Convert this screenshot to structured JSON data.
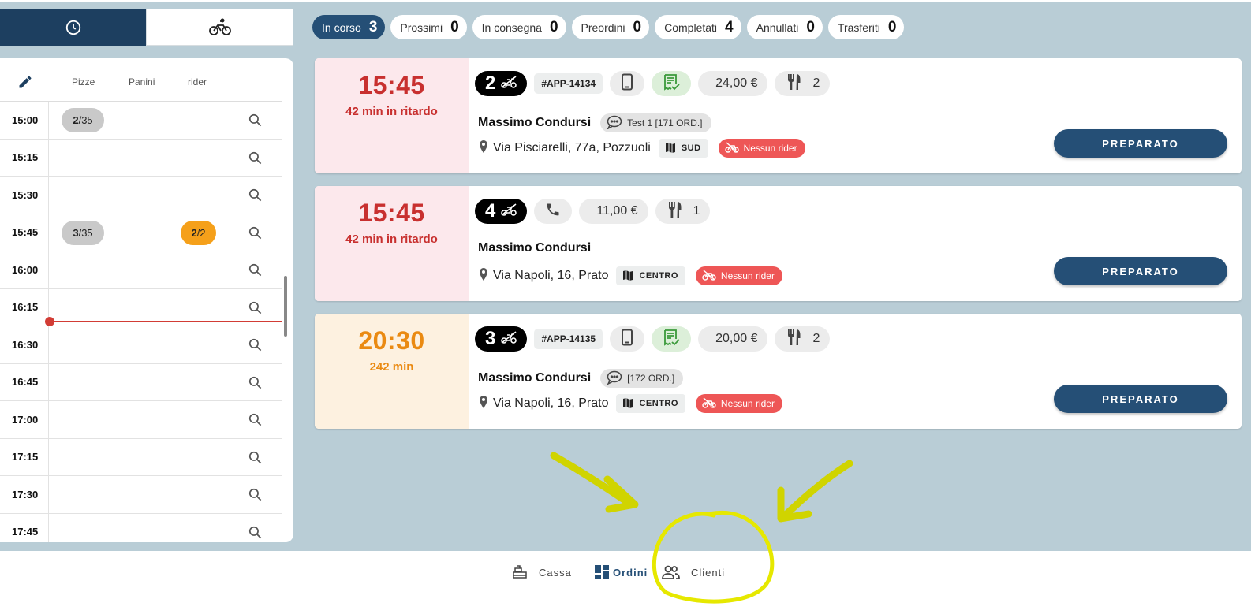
{
  "view_tabs": [
    {
      "icon": "clock-icon",
      "active": true
    },
    {
      "icon": "bicycle-icon",
      "active": false
    }
  ],
  "filters": [
    {
      "label": "In corso",
      "count": "3",
      "active": true
    },
    {
      "label": "Prossimi",
      "count": "0"
    },
    {
      "label": "In consegna",
      "count": "0"
    },
    {
      "label": "Preordini",
      "count": "0"
    },
    {
      "label": "Completati",
      "count": "4"
    },
    {
      "label": "Annullati",
      "count": "0"
    },
    {
      "label": "Trasferiti",
      "count": "0"
    }
  ],
  "schedule": {
    "columns": [
      "Pizze",
      "Panini",
      "rider"
    ],
    "rows": [
      {
        "time": "15:00",
        "pizze_num": "2",
        "pizze_den": "/35",
        "rider_num": null,
        "rider_den": null
      },
      {
        "time": "15:15"
      },
      {
        "time": "15:30"
      },
      {
        "time": "15:45",
        "pizze_num": "3",
        "pizze_den": "/35",
        "rider_num": "2",
        "rider_den": "/2"
      },
      {
        "time": "16:00"
      },
      {
        "time": "16:15"
      },
      {
        "time": "16:30"
      },
      {
        "time": "16:45"
      },
      {
        "time": "17:00"
      },
      {
        "time": "17:15"
      },
      {
        "time": "17:30"
      },
      {
        "time": "17:45"
      }
    ]
  },
  "orders": [
    {
      "time": "15:45",
      "status": "42 min in ritardo",
      "state": "late",
      "number": "2",
      "code": "#APP-14134",
      "channel_icon": "smartphone-icon",
      "receipt": true,
      "price": "24,00 €",
      "covers": "2",
      "customer": "Massimo Condursi",
      "note": "Test 1 [171 ORD.]",
      "address": "Via Pisciarelli, 77a, Pozzuoli",
      "zone": "SUD",
      "rider": "Nessun rider",
      "action": "PREPARATO"
    },
    {
      "time": "15:45",
      "status": "42 min in ritardo",
      "state": "late",
      "number": "4",
      "code": null,
      "channel_icon": "phone-icon",
      "receipt": false,
      "price": "11,00 €",
      "covers": "1",
      "customer": "Massimo Condursi",
      "note": null,
      "address": "Via Napoli, 16, Prato",
      "zone": "CENTRO",
      "rider": "Nessun rider",
      "action": "PREPARATO"
    },
    {
      "time": "20:30",
      "status": "242 min",
      "state": "future",
      "number": "3",
      "code": "#APP-14135",
      "channel_icon": "smartphone-icon",
      "receipt": true,
      "price": "20,00 €",
      "covers": "2",
      "customer": "Massimo Condursi",
      "note": "[172 ORD.]",
      "address": "Via Napoli, 16, Prato",
      "zone": "CENTRO",
      "rider": "Nessun rider",
      "action": "PREPARATO"
    }
  ],
  "bottom_nav": [
    {
      "label": "Cassa",
      "icon": "cash-register-icon"
    },
    {
      "label": "Ordini",
      "icon": "dashboard-icon",
      "active": true
    },
    {
      "label": "Clienti",
      "icon": "people-icon"
    }
  ],
  "colors": {
    "primary": "#254f76",
    "dark_tab": "#1d3f60",
    "late": "#c8302f",
    "future": "#ea8a12",
    "rider_alert": "#ee5656",
    "background": "#b9cdd6",
    "annotation": "#d8db00"
  }
}
